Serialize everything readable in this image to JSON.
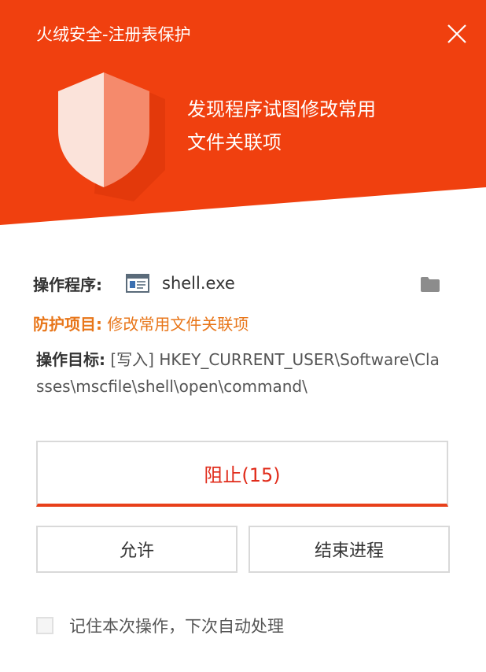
{
  "window": {
    "title": "火绒安全-注册表保护",
    "close_icon": "close-icon"
  },
  "alert": {
    "headline_line1": "发现程序试图修改常用",
    "headline_line2": "文件关联项",
    "shield_icon": "shield-icon"
  },
  "details": {
    "program_label": "操作程序:",
    "program_name": "shell.exe",
    "program_icon": "exe-window-icon",
    "folder_icon": "folder-icon",
    "protect_label": "防护项目:",
    "protect_value": "修改常用文件关联项",
    "target_label": "操作目标:",
    "target_value": "[写入] HKEY_CURRENT_USER\\Software\\Classes\\mscfile\\shell\\open\\command\\"
  },
  "actions": {
    "block_label": "阻止(15)",
    "allow_label": "允许",
    "end_process_label": "结束进程"
  },
  "remember": {
    "label": "记住本次操作，下次自动处理",
    "checked": false
  },
  "colors": {
    "header_red": "#f0400f",
    "warning_orange": "#e8761a",
    "block_red": "#e02b1a"
  }
}
